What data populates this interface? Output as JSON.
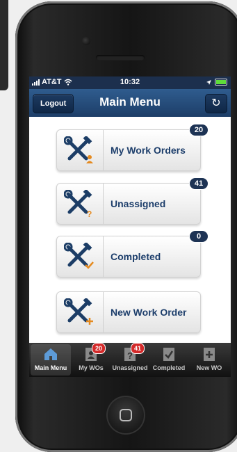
{
  "status_bar": {
    "carrier": "AT&T",
    "time": "10:32"
  },
  "nav": {
    "logout_label": "Logout",
    "title": "Main Menu",
    "refresh_icon": "refresh-icon"
  },
  "menu": {
    "items": [
      {
        "label": "My Work Orders",
        "badge": "20",
        "icon": "tools-user-icon"
      },
      {
        "label": "Unassigned",
        "badge": "41",
        "icon": "tools-question-icon"
      },
      {
        "label": "Completed",
        "badge": "0",
        "icon": "tools-check-icon"
      },
      {
        "label": "New Work Order",
        "icon": "tools-plus-icon"
      }
    ]
  },
  "tabbar": {
    "tabs": [
      {
        "label": "Main Menu",
        "icon": "home-icon",
        "active": true
      },
      {
        "label": "My WOs",
        "badge": "20",
        "icon": "user-doc-icon"
      },
      {
        "label": "Unassigned",
        "badge": "41",
        "icon": "question-doc-icon"
      },
      {
        "label": "Completed",
        "icon": "check-doc-icon"
      },
      {
        "label": "New WO",
        "icon": "plus-doc-icon"
      }
    ]
  },
  "colors": {
    "nav_blue": "#1d3e68",
    "badge_navy": "#1d3354",
    "tab_badge_red": "#d42a2a",
    "label_blue": "#1d3e6b",
    "accent_orange": "#e58a1f"
  }
}
